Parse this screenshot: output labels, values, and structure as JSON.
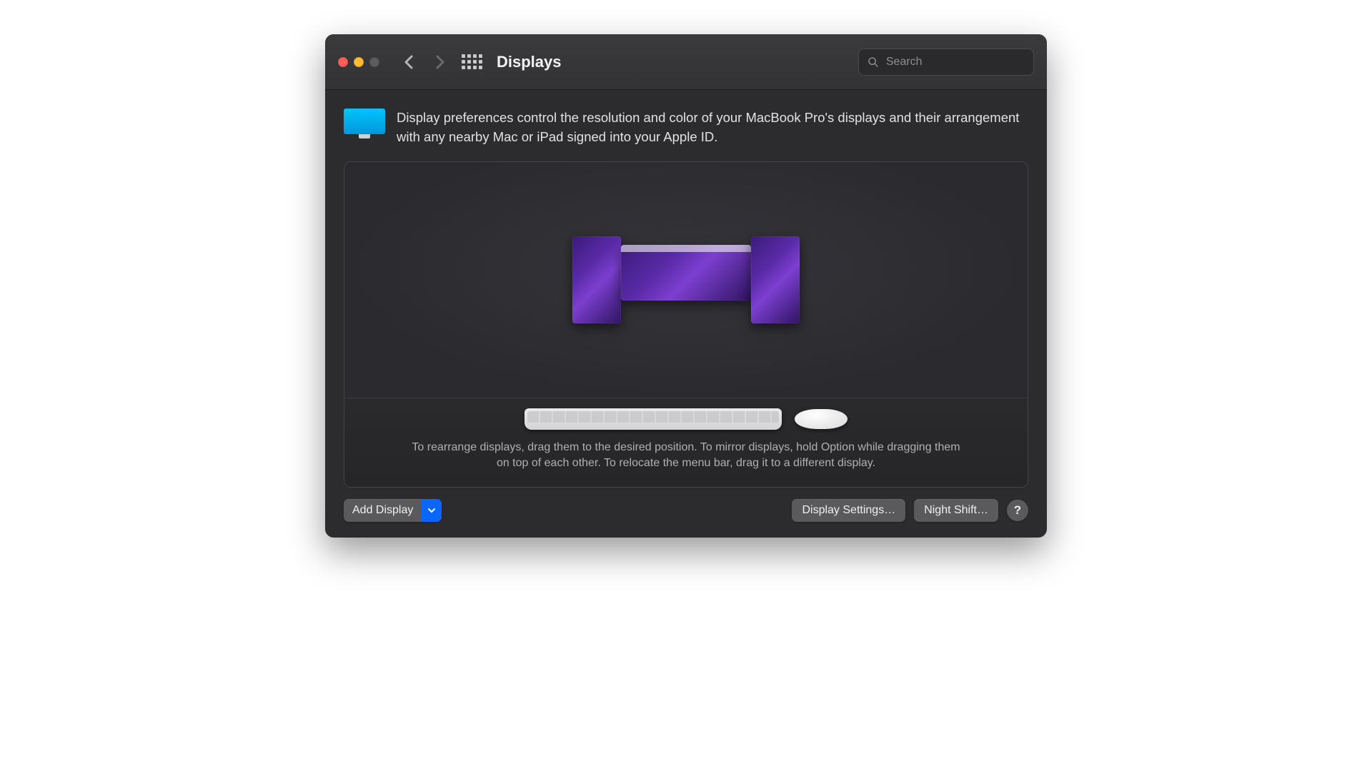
{
  "window": {
    "title": "Displays"
  },
  "search": {
    "placeholder": "Search",
    "value": ""
  },
  "intro": {
    "text": "Display preferences control the resolution and color of your MacBook Pro's displays and their arrangement with any nearby Mac or iPad signed into your Apple ID."
  },
  "arrangement": {
    "hint": "To rearrange displays, drag them to the desired position. To mirror displays, hold Option while dragging them on top of each other. To relocate the menu bar, drag it to a different display."
  },
  "buttons": {
    "add_display": "Add Display",
    "display_settings": "Display Settings…",
    "night_shift": "Night Shift…",
    "help": "?"
  }
}
